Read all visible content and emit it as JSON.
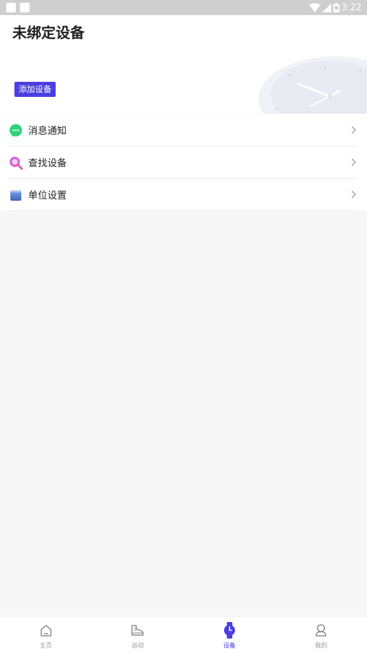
{
  "status_bar": {
    "time": "3:22"
  },
  "header": {
    "title": "未绑定设备",
    "add_button": "添加设备"
  },
  "menu": [
    {
      "label": "消息通知",
      "icon": "message-icon"
    },
    {
      "label": "查找设备",
      "icon": "find-device-icon"
    },
    {
      "label": "单位设置",
      "icon": "unit-km-icon"
    }
  ],
  "tabbar": {
    "active": 2,
    "tabs": [
      {
        "label": "主页",
        "icon": "home-icon"
      },
      {
        "label": "运动",
        "icon": "sneaker-icon"
      },
      {
        "label": "设备",
        "icon": "watch-icon"
      },
      {
        "label": "我的",
        "icon": "profile-icon"
      }
    ]
  },
  "colors": {
    "accent": "#4b3fe0",
    "background": "#f7f7f8"
  }
}
